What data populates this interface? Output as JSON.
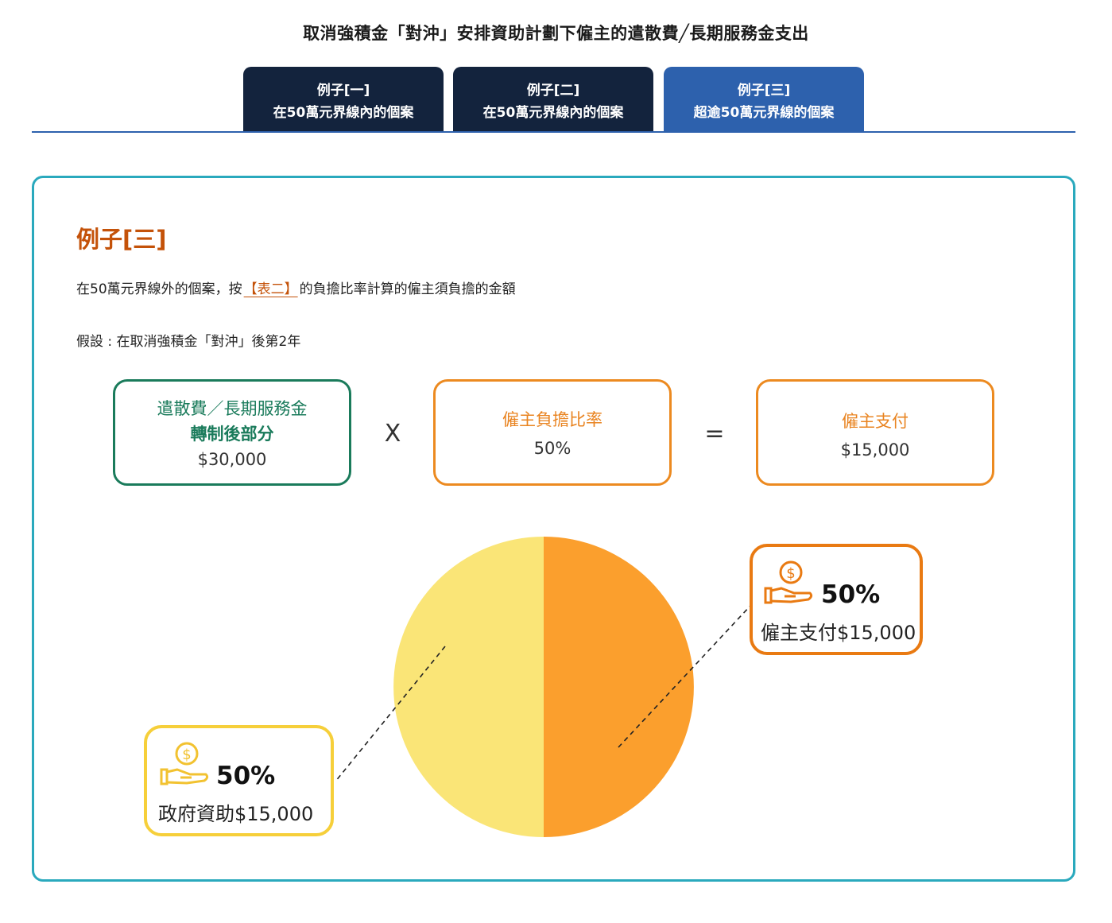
{
  "page_title": "取消強積金「對沖」安排資助計劃下僱主的遣散費╱長期服務金支出",
  "tabs": [
    {
      "line1": "例子[一]",
      "line2": "在50萬元界線內的個案",
      "active": false
    },
    {
      "line1": "例子[二]",
      "line2": "在50萬元界線內的個案",
      "active": false
    },
    {
      "line1": "例子[三]",
      "line2": "超逾50萬元界線的個案",
      "active": true
    }
  ],
  "example": {
    "title": "例子[三]",
    "desc_before": "在50萬元界線外的個案，按",
    "desc_link": "【表二】",
    "desc_after": "的負擔比率計算的僱主須負擔的金額",
    "assumption": "假設 : 在取消強積金「對沖」後第2年"
  },
  "formula": {
    "box1": {
      "line1": "遣散費／長期服務金",
      "line2": "轉制後部分",
      "value": "$30,000"
    },
    "op1": "X",
    "box2": {
      "line1": "僱主負擔比率",
      "value": "50%"
    },
    "op2": "=",
    "box3": {
      "line1": "僱主支付",
      "value": "$15,000"
    }
  },
  "pie": {
    "colors": {
      "employer": "#fb9f2d",
      "government": "#fae577"
    },
    "icons": [
      "hand-coin-icon",
      "hand-coin-icon"
    ],
    "employer": {
      "percent": "50%",
      "label": "僱主支付$15,000",
      "share": 0.5
    },
    "government": {
      "percent": "50%",
      "label": "政府資助$15,000",
      "share": 0.5
    }
  }
}
